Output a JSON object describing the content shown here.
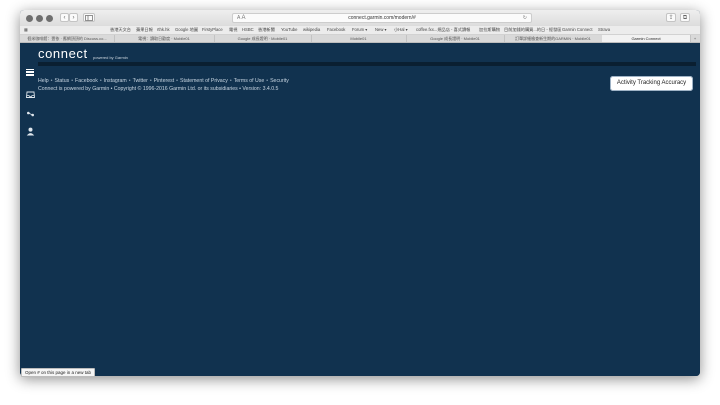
{
  "browser": {
    "url": "connect.garmin.com/modern/#",
    "sidebar_toggle_icon": "sidebar-icon",
    "reader_label": "A",
    "reader_label_large": "A",
    "reload_glyph": "↻",
    "back_glyph": "‹",
    "forward_glyph": "›",
    "share_glyph": "⇪",
    "tabs_glyph": "⧉",
    "new_tab_glyph": "+",
    "bookmarks": [
      "香港天文台",
      "蘋果日報",
      "rthk.hk",
      "Google 地圖",
      "FirstyPlace",
      "電視",
      "HSBC",
      "香港新聞",
      "YouTube",
      "wikipedia",
      "Facebook",
      "Forum ▾",
      "New ▾",
      "小Hal ▾",
      "coffee.fxx...規品店 - 喜式讀報",
      "加拉斯購物",
      "目前加錢的購買...的日 - 經發區",
      "Garmin Connect",
      "Strava"
    ],
    "tabs": [
      {
        "label": "個米咖啡館：壹依 · 應網頂頂的 Discuss.co...",
        "active": false
      },
      {
        "label": "電視：讀取日歡度 · Mobile01",
        "active": false
      },
      {
        "label": "Google 成長證明 · Mobile01",
        "active": false
      },
      {
        "label": "Mobile01",
        "active": false
      },
      {
        "label": "Google 成長證明 · Mobile01",
        "active": false
      },
      {
        "label": "訂單詳細檢查新生期的GARMIN · Mobile01",
        "active": false
      },
      {
        "label": "Garmin Connect",
        "active": true
      }
    ],
    "status_text": "Open # on this page in a new tab"
  },
  "page": {
    "logo_text": "connect",
    "logo_sub": "powered by Garmin",
    "footer_links": [
      "Help",
      "Status",
      "Facebook",
      "Instagram",
      "Twitter",
      "Pinterest",
      "Statement of Privacy",
      "Terms of Use",
      "Security"
    ],
    "separator": "•",
    "copyright": "Connect is powered by Garmin • Copyright © 1996-2016 Garmin Ltd. or its subsidiaries • Version: 3.4.0.5",
    "accuracy_button": "Activity Tracking Accuracy",
    "sidebar_icons": [
      "menu-icon",
      "inbox-icon",
      "connections-icon",
      "profile-icon"
    ]
  },
  "colors": {
    "page_bg": "#11324f",
    "header_bar": "#0a1f31",
    "link_text": "#c9d6e2"
  }
}
